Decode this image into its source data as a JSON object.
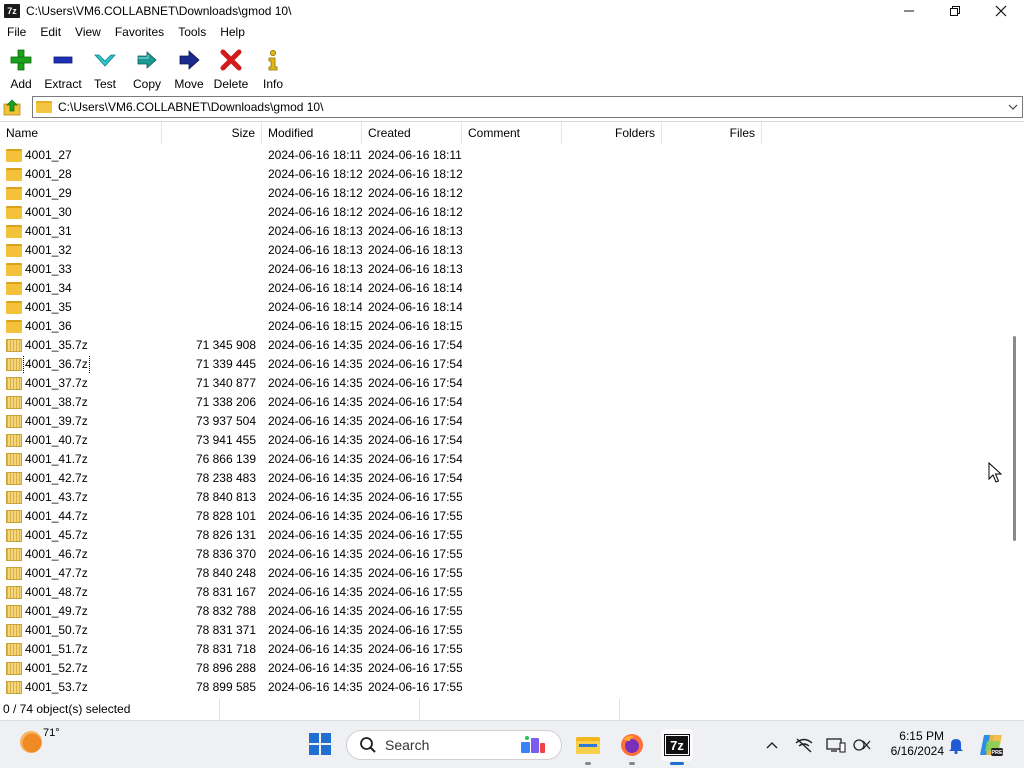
{
  "window": {
    "title": "C:\\Users\\VM6.COLLABNET\\Downloads\\gmod 10\\",
    "app_icon_text": "7z",
    "controls": [
      "minimize-icon",
      "maximize-icon",
      "close-icon"
    ]
  },
  "menu": {
    "items": [
      "File",
      "Edit",
      "View",
      "Favorites",
      "Tools",
      "Help"
    ]
  },
  "toolbar": {
    "buttons": [
      {
        "label": "Add",
        "icon": "plus-icon",
        "color": "#1aa31a"
      },
      {
        "label": "Extract",
        "icon": "minus-icon",
        "color": "#1f2fb8"
      },
      {
        "label": "Test",
        "icon": "check-chevron-icon",
        "color": "#1ab0b8"
      },
      {
        "label": "Copy",
        "icon": "double-arrow-icon",
        "color": "#178a85"
      },
      {
        "label": "Move",
        "icon": "arrow-right-icon",
        "color": "#1b2a8c"
      },
      {
        "label": "Delete",
        "icon": "x-icon",
        "color": "#d21b1b"
      },
      {
        "label": "Info",
        "icon": "info-icon",
        "color": "#c8a010"
      }
    ]
  },
  "address": {
    "path": "C:\\Users\\VM6.COLLABNET\\Downloads\\gmod 10\\"
  },
  "columns": [
    "Name",
    "Size",
    "Modified",
    "Created",
    "Comment",
    "Folders",
    "Files"
  ],
  "rows": [
    {
      "name": "4001_27",
      "type": "folder",
      "size": "",
      "modified": "2024-06-16 18:11",
      "created": "2024-06-16 18:11"
    },
    {
      "name": "4001_28",
      "type": "folder",
      "size": "",
      "modified": "2024-06-16 18:12",
      "created": "2024-06-16 18:12"
    },
    {
      "name": "4001_29",
      "type": "folder",
      "size": "",
      "modified": "2024-06-16 18:12",
      "created": "2024-06-16 18:12"
    },
    {
      "name": "4001_30",
      "type": "folder",
      "size": "",
      "modified": "2024-06-16 18:12",
      "created": "2024-06-16 18:12"
    },
    {
      "name": "4001_31",
      "type": "folder",
      "size": "",
      "modified": "2024-06-16 18:13",
      "created": "2024-06-16 18:13"
    },
    {
      "name": "4001_32",
      "type": "folder",
      "size": "",
      "modified": "2024-06-16 18:13",
      "created": "2024-06-16 18:13"
    },
    {
      "name": "4001_33",
      "type": "folder",
      "size": "",
      "modified": "2024-06-16 18:13",
      "created": "2024-06-16 18:13"
    },
    {
      "name": "4001_34",
      "type": "folder",
      "size": "",
      "modified": "2024-06-16 18:14",
      "created": "2024-06-16 18:14"
    },
    {
      "name": "4001_35",
      "type": "folder",
      "size": "",
      "modified": "2024-06-16 18:14",
      "created": "2024-06-16 18:14"
    },
    {
      "name": "4001_36",
      "type": "folder",
      "size": "",
      "modified": "2024-06-16 18:15",
      "created": "2024-06-16 18:15"
    },
    {
      "name": "4001_35.7z",
      "type": "archive",
      "size": "71 345 908",
      "modified": "2024-06-16 14:35",
      "created": "2024-06-16 17:54"
    },
    {
      "name": "4001_36.7z",
      "type": "archive",
      "size": "71 339 445",
      "modified": "2024-06-16 14:35",
      "created": "2024-06-16 17:54",
      "focused": true
    },
    {
      "name": "4001_37.7z",
      "type": "archive",
      "size": "71 340 877",
      "modified": "2024-06-16 14:35",
      "created": "2024-06-16 17:54"
    },
    {
      "name": "4001_38.7z",
      "type": "archive",
      "size": "71 338 206",
      "modified": "2024-06-16 14:35",
      "created": "2024-06-16 17:54"
    },
    {
      "name": "4001_39.7z",
      "type": "archive",
      "size": "73 937 504",
      "modified": "2024-06-16 14:35",
      "created": "2024-06-16 17:54"
    },
    {
      "name": "4001_40.7z",
      "type": "archive",
      "size": "73 941 455",
      "modified": "2024-06-16 14:35",
      "created": "2024-06-16 17:54"
    },
    {
      "name": "4001_41.7z",
      "type": "archive",
      "size": "76 866 139",
      "modified": "2024-06-16 14:35",
      "created": "2024-06-16 17:54"
    },
    {
      "name": "4001_42.7z",
      "type": "archive",
      "size": "78 238 483",
      "modified": "2024-06-16 14:35",
      "created": "2024-06-16 17:54"
    },
    {
      "name": "4001_43.7z",
      "type": "archive",
      "size": "78 840 813",
      "modified": "2024-06-16 14:35",
      "created": "2024-06-16 17:55"
    },
    {
      "name": "4001_44.7z",
      "type": "archive",
      "size": "78 828 101",
      "modified": "2024-06-16 14:35",
      "created": "2024-06-16 17:55"
    },
    {
      "name": "4001_45.7z",
      "type": "archive",
      "size": "78 826 131",
      "modified": "2024-06-16 14:35",
      "created": "2024-06-16 17:55"
    },
    {
      "name": "4001_46.7z",
      "type": "archive",
      "size": "78 836 370",
      "modified": "2024-06-16 14:35",
      "created": "2024-06-16 17:55"
    },
    {
      "name": "4001_47.7z",
      "type": "archive",
      "size": "78 840 248",
      "modified": "2024-06-16 14:35",
      "created": "2024-06-16 17:55"
    },
    {
      "name": "4001_48.7z",
      "type": "archive",
      "size": "78 831 167",
      "modified": "2024-06-16 14:35",
      "created": "2024-06-16 17:55"
    },
    {
      "name": "4001_49.7z",
      "type": "archive",
      "size": "78 832 788",
      "modified": "2024-06-16 14:35",
      "created": "2024-06-16 17:55"
    },
    {
      "name": "4001_50.7z",
      "type": "archive",
      "size": "78 831 371",
      "modified": "2024-06-16 14:35",
      "created": "2024-06-16 17:55"
    },
    {
      "name": "4001_51.7z",
      "type": "archive",
      "size": "78 831 718",
      "modified": "2024-06-16 14:35",
      "created": "2024-06-16 17:55"
    },
    {
      "name": "4001_52.7z",
      "type": "archive",
      "size": "78 896 288",
      "modified": "2024-06-16 14:35",
      "created": "2024-06-16 17:55"
    },
    {
      "name": "4001_53.7z",
      "type": "archive",
      "size": "78 899 585",
      "modified": "2024-06-16 14:35",
      "created": "2024-06-16 17:55"
    }
  ],
  "status": {
    "selection": "0 / 74 object(s) selected"
  },
  "taskbar": {
    "weather_temp": "71°",
    "search_label": "Search",
    "time": "6:15 PM",
    "date": "6/16/2024",
    "accent": "#1f6fd1"
  }
}
